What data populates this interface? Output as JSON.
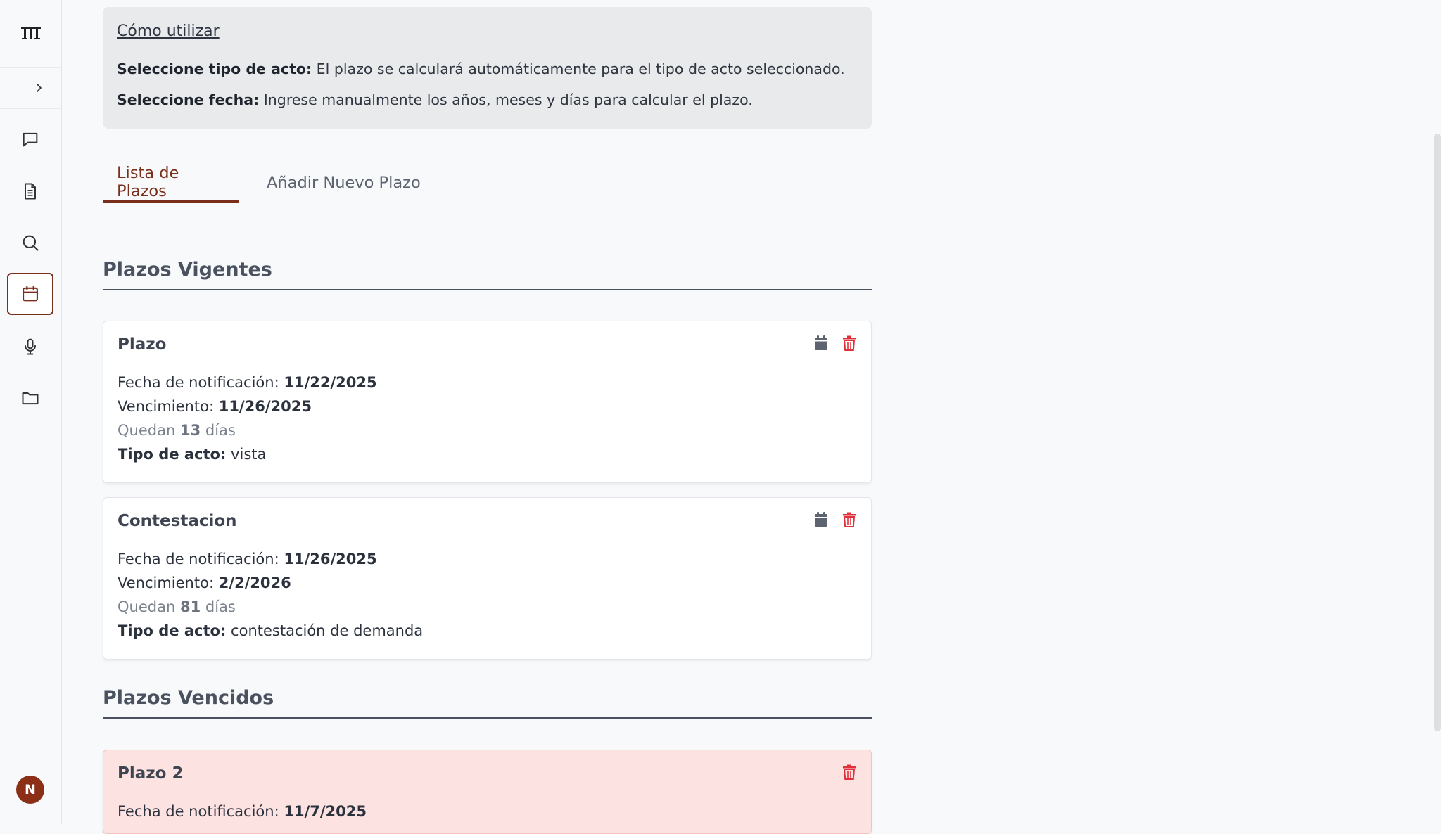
{
  "sidebar": {
    "logo": "ꟷTTT",
    "avatar_initial": "N",
    "items": [
      {
        "icon": "chat-icon"
      },
      {
        "icon": "document-icon"
      },
      {
        "icon": "search-icon"
      },
      {
        "icon": "calendar-icon",
        "active": true
      },
      {
        "icon": "microphone-icon"
      },
      {
        "icon": "folder-icon"
      }
    ]
  },
  "info": {
    "title": "Cómo utilizar",
    "line1_bold": "Seleccione tipo de acto:",
    "line1_text": " El plazo se calculará automáticamente para el tipo de acto seleccionado.",
    "line2_bold": "Seleccione fecha:",
    "line2_text": " Ingrese manualmente los años, meses y días para calcular el plazo."
  },
  "tabs": [
    {
      "label": "Lista de Plazos",
      "active": true
    },
    {
      "label": "Añadir Nuevo Plazo",
      "active": false
    }
  ],
  "sections": {
    "vigentes": "Plazos Vigentes",
    "vencidos": "Plazos Vencidos"
  },
  "labels": {
    "notificacion": "Fecha de notificación: ",
    "vencimiento": "Vencimiento: ",
    "quedan": "Quedan ",
    "dias": " días",
    "tipo": "Tipo de acto:"
  },
  "cards": [
    {
      "title": "Plazo",
      "notificacion": "11/22/2025",
      "vencimiento": "11/26/2025",
      "quedan": "13",
      "tipo": " vista"
    },
    {
      "title": "Contestacion",
      "notificacion": "11/26/2025",
      "vencimiento": "2/2/2026",
      "quedan": "81",
      "tipo": " contestación de demanda"
    }
  ],
  "expired_cards": [
    {
      "title": "Plazo 2",
      "notificacion": "11/7/2025"
    }
  ],
  "colors": {
    "accent": "#7a2f1c",
    "delete": "#e0303a",
    "expired_bg": "#fde2e2"
  }
}
